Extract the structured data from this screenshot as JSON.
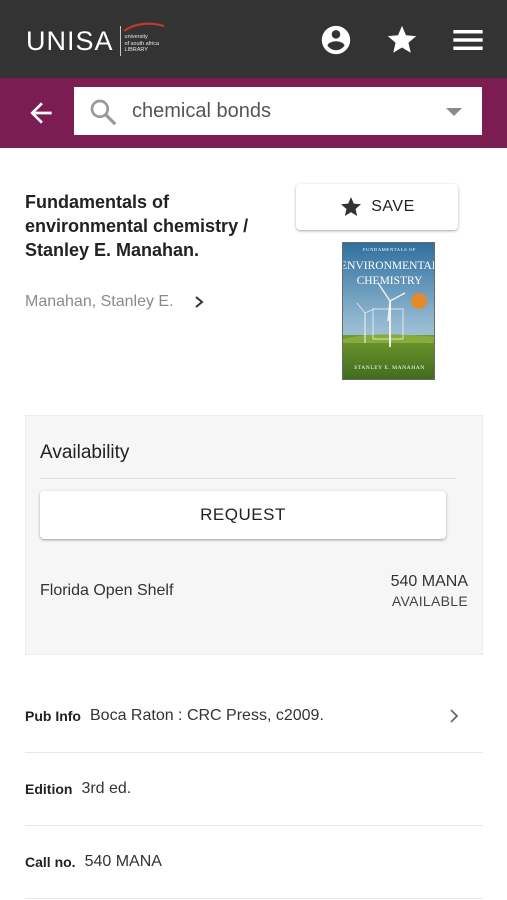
{
  "header": {
    "logo_word": "UNISA",
    "logo_sub_line1": "university",
    "logo_sub_line2": "of south africa",
    "logo_sub_line3": "LIBRARY",
    "icons": [
      "account-circle-icon",
      "star-icon",
      "menu-icon"
    ]
  },
  "search": {
    "value": "chemical bonds",
    "icons": [
      "back-arrow-icon",
      "search-icon",
      "dropdown-caret-icon"
    ]
  },
  "record": {
    "title": "Fundamentals of environmental chemistry / Stanley E. Manahan.",
    "author": "Manahan, Stanley E.",
    "save_label": "SAVE",
    "cover": {
      "series_line": "FUNDAMENTALS OF",
      "title_line1": "ENVIRONMENTAL",
      "title_line2": "CHEMISTRY",
      "author_line": "STANLEY E. MANAHAN"
    }
  },
  "availability": {
    "heading": "Availability",
    "request_label": "REQUEST",
    "location": "Florida Open Shelf",
    "call_number": "540 MANA",
    "status": "AVAILABLE"
  },
  "details": [
    {
      "label": "Pub Info",
      "value": "Boca Raton : CRC Press, c2009."
    },
    {
      "label": "Edition",
      "value": "3rd ed."
    },
    {
      "label": "Call no.",
      "value": "540 MANA"
    }
  ],
  "colors": {
    "topbar": "#333333",
    "search_band": "#7b1c52",
    "white": "#ffffff"
  }
}
